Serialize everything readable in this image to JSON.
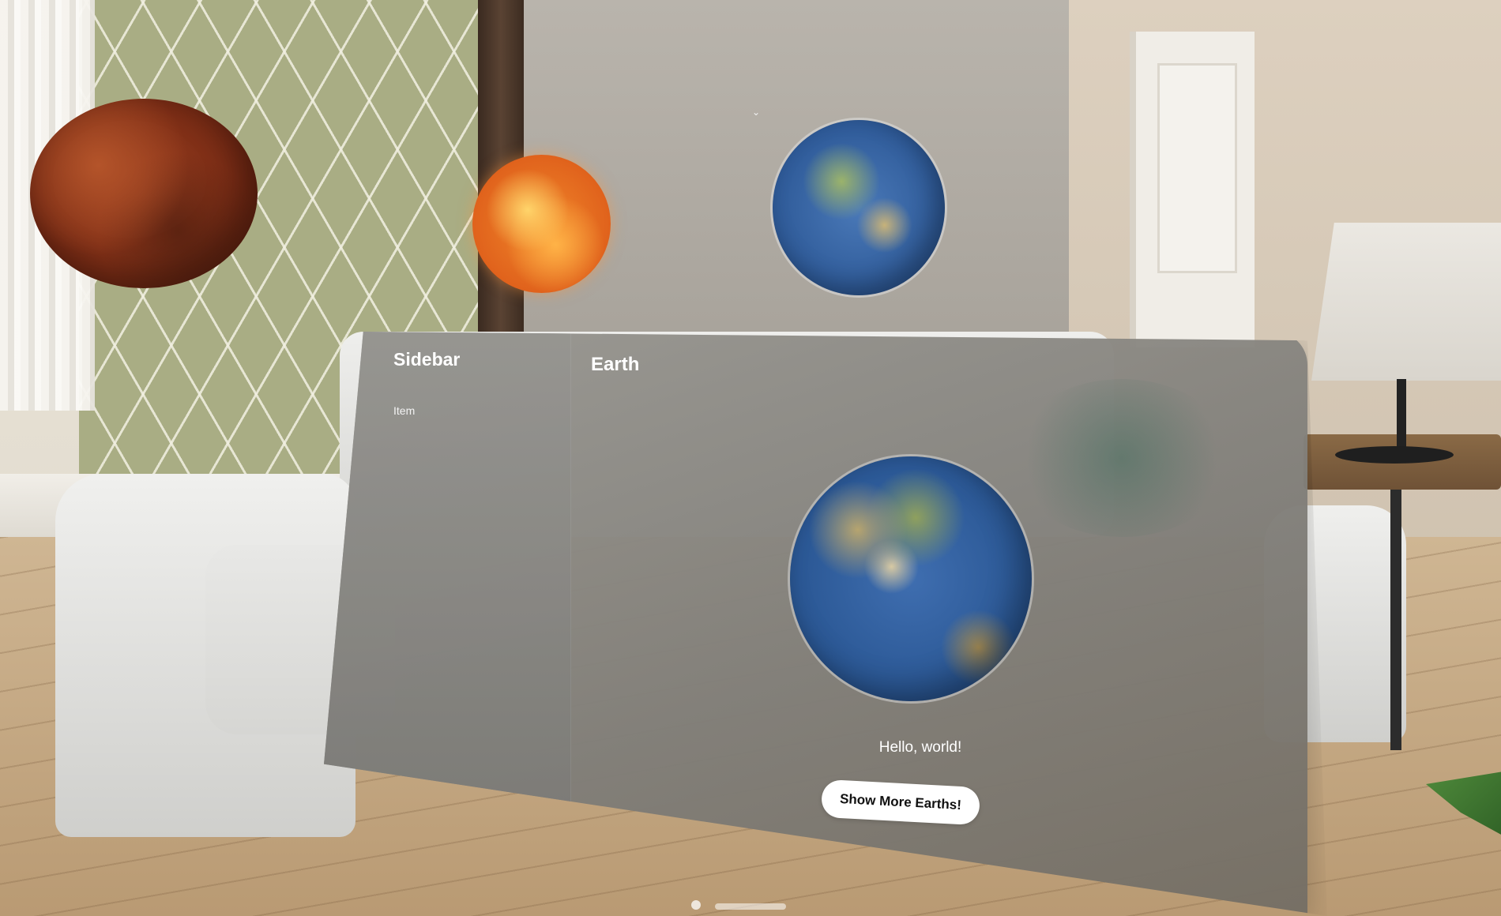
{
  "sidebar": {
    "title": "Sidebar",
    "items": [
      {
        "label": "Item"
      }
    ]
  },
  "detail": {
    "title": "Earth",
    "message": "Hello, world!",
    "button_label": "Show More Earths!"
  },
  "icons": {
    "window_grabber": "chevron-down-icon"
  },
  "colors": {
    "button_background": "#ffffff",
    "button_text": "#111111",
    "title_text": "#ffffff"
  }
}
